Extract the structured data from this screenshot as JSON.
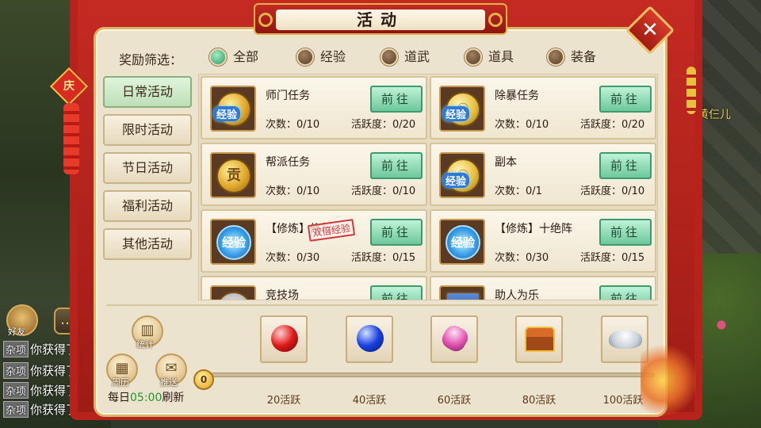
{
  "window": {
    "title": "活动",
    "close_label": "✕"
  },
  "filter": {
    "label": "奖励筛选：",
    "options": [
      {
        "label": "全部",
        "selected": true
      },
      {
        "label": "经验",
        "selected": false
      },
      {
        "label": "道武",
        "selected": false
      },
      {
        "label": "道具",
        "selected": false
      },
      {
        "label": "装备",
        "selected": false
      }
    ]
  },
  "categories": [
    {
      "label": "日常活动",
      "active": true
    },
    {
      "label": "限时活动",
      "active": false
    },
    {
      "label": "节日活动",
      "active": false
    },
    {
      "label": "福利活动",
      "active": false
    },
    {
      "label": "其他活动",
      "active": false
    }
  ],
  "activities": [
    {
      "name": "师门任务",
      "count": "次数：0/10",
      "activity": "活跃度：0/20",
      "button": "前往",
      "icon": "gold-coin-exp-icon",
      "icon_text": "",
      "badge": "经验"
    },
    {
      "name": "除暴任务",
      "count": "次数：0/10",
      "activity": "活跃度：0/20",
      "button": "前往",
      "icon": "yinyang-coin-exp-icon",
      "icon_text": "☯",
      "badge": "经验"
    },
    {
      "name": "帮派任务",
      "count": "次数：0/10",
      "activity": "活跃度：0/10",
      "button": "前往",
      "icon": "gong-coin-icon",
      "icon_text": "贡",
      "badge": ""
    },
    {
      "name": "副本",
      "count": "次数：0/1",
      "activity": "活跃度：0/10",
      "button": "前往",
      "icon": "yinyang-coin-exp-icon",
      "icon_text": "☯",
      "badge": "经验"
    },
    {
      "name": "【修炼】修行",
      "count": "次数：0/30",
      "activity": "活跃度：0/15",
      "button": "前往",
      "icon": "exp-orb-icon",
      "icon_text": "经验",
      "badge": "",
      "stamp": "双倍经验"
    },
    {
      "name": "【修炼】十绝阵",
      "count": "次数：0/30",
      "activity": "活跃度：0/15",
      "button": "前往",
      "icon": "exp-orb-icon",
      "icon_text": "经验",
      "badge": ""
    },
    {
      "name": "竞技场",
      "count": "",
      "activity": "",
      "button": "前往",
      "icon": "silver-disc-icon",
      "icon_text": "",
      "badge": ""
    },
    {
      "name": "助人为乐",
      "count": "",
      "activity": "",
      "button": "前往",
      "icon": "scroll-icon",
      "icon_text": "",
      "badge": ""
    }
  ],
  "bottom": {
    "stats_label": "统计",
    "calendar_label": "周历",
    "push_label": "推送",
    "refresh_prefix": "每日",
    "refresh_time": "05:00",
    "refresh_suffix": "刷新",
    "current_points": "0",
    "progress_fraction": 0,
    "rewards": [
      {
        "tier": "20活跃",
        "item": "red-gem-icon"
      },
      {
        "tier": "40活跃",
        "item": "blue-gem-icon"
      },
      {
        "tier": "60活跃",
        "item": "pink-crystal-icon"
      },
      {
        "tier": "80活跃",
        "item": "treasure-chest-icon"
      },
      {
        "tier": "100活跃",
        "item": "silver-ingot-icon"
      }
    ]
  },
  "chat": {
    "friend_label": "好友",
    "lines": [
      {
        "tag": "杂项",
        "text": "你获得了"
      },
      {
        "tag": "杂项",
        "text": "你获得了"
      },
      {
        "tag": "杂项",
        "text": "你获得了"
      },
      {
        "tag": "杂项",
        "text": "你获得了"
      }
    ]
  },
  "npc_name": "黄仨儿",
  "ornament_text": "庆",
  "colors": {
    "frame_red": "#b8221c",
    "panel_bg": "#ece3cf",
    "button_green": "#6cc89a",
    "time_green": "#1a9a2a"
  }
}
